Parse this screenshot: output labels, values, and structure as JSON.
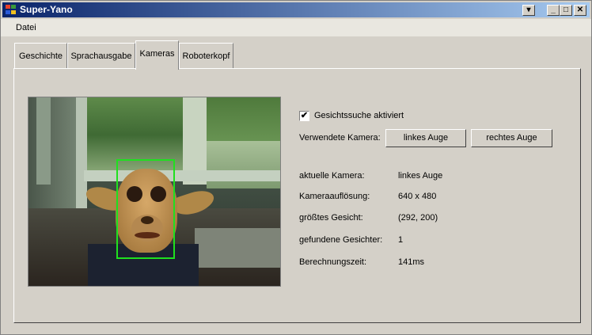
{
  "window": {
    "title": "Super-Yano",
    "controls": {
      "system_menu": "▾",
      "minimize": "_",
      "maximize": "□",
      "close": "✕"
    }
  },
  "menu": {
    "items": [
      "Datei"
    ]
  },
  "tabs": [
    {
      "label": "Geschichte"
    },
    {
      "label": "Sprachausgabe"
    },
    {
      "label": "Kameras"
    },
    {
      "label": "Roboterkopf"
    }
  ],
  "active_tab": "Kameras",
  "camera_panel": {
    "face_detection": {
      "label": "Gesichtssuche aktiviert",
      "checked": true,
      "check_glyph": "✔"
    },
    "camera_select": {
      "label": "Verwendete Kamera:",
      "left_button": "linkes Auge",
      "right_button": "rechtes Auge"
    },
    "info": [
      {
        "label": "aktuelle Kamera:",
        "value": "linkes Auge"
      },
      {
        "label": "Kameraauflösung:",
        "value": "640 x 480"
      },
      {
        "label": "größtes Gesicht:",
        "value": "(292, 200)"
      },
      {
        "label": "gefundene Gesichter:",
        "value": "1"
      },
      {
        "label": "Berechnungszeit:",
        "value": "141ms"
      }
    ]
  },
  "colors": {
    "title_gradient_start": "#0a246a",
    "title_gradient_end": "#a6caf0",
    "face_box": "#1fe01f"
  }
}
